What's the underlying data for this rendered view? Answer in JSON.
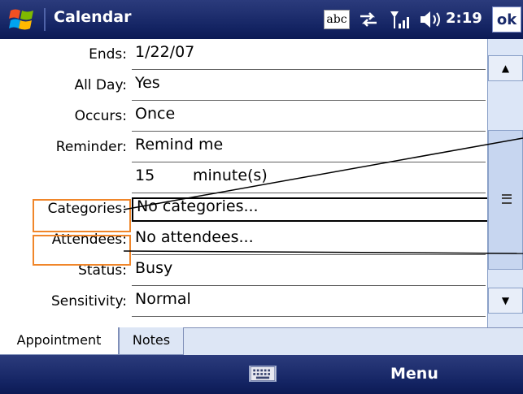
{
  "titlebar": {
    "app_title": "Calendar",
    "input_indicator": "abc",
    "clock": "2:19",
    "ok_label": "ok",
    "icons": [
      "windows-start-icon",
      "keyboard-abc-icon",
      "sync-arrows-icon",
      "signal-strength-icon",
      "volume-icon"
    ]
  },
  "form": {
    "rows": [
      {
        "label": "Ends:",
        "value": "1/22/07"
      },
      {
        "label": "All Day:",
        "value": "Yes"
      },
      {
        "label": "Occurs:",
        "value": "Once"
      },
      {
        "label": "Reminder:",
        "value": "Remind me"
      },
      {
        "label": "",
        "value": "15",
        "unit": "minute(s)"
      },
      {
        "label": "Categories:",
        "value": "No categories..."
      },
      {
        "label": "Attendees:",
        "value": "No attendees..."
      },
      {
        "label": "Status:",
        "value": "Busy"
      },
      {
        "label": "Sensitivity:",
        "value": "Normal"
      }
    ]
  },
  "tabs": [
    {
      "label": "Appointment",
      "selected": true
    },
    {
      "label": "Notes",
      "selected": false
    }
  ],
  "softkeys": {
    "right": "Menu",
    "center_icon": "keyboard-icon"
  },
  "colors": {
    "titlebar": "#142463",
    "highlight": "#f0862a",
    "tab_bg": "#dde6f5"
  }
}
